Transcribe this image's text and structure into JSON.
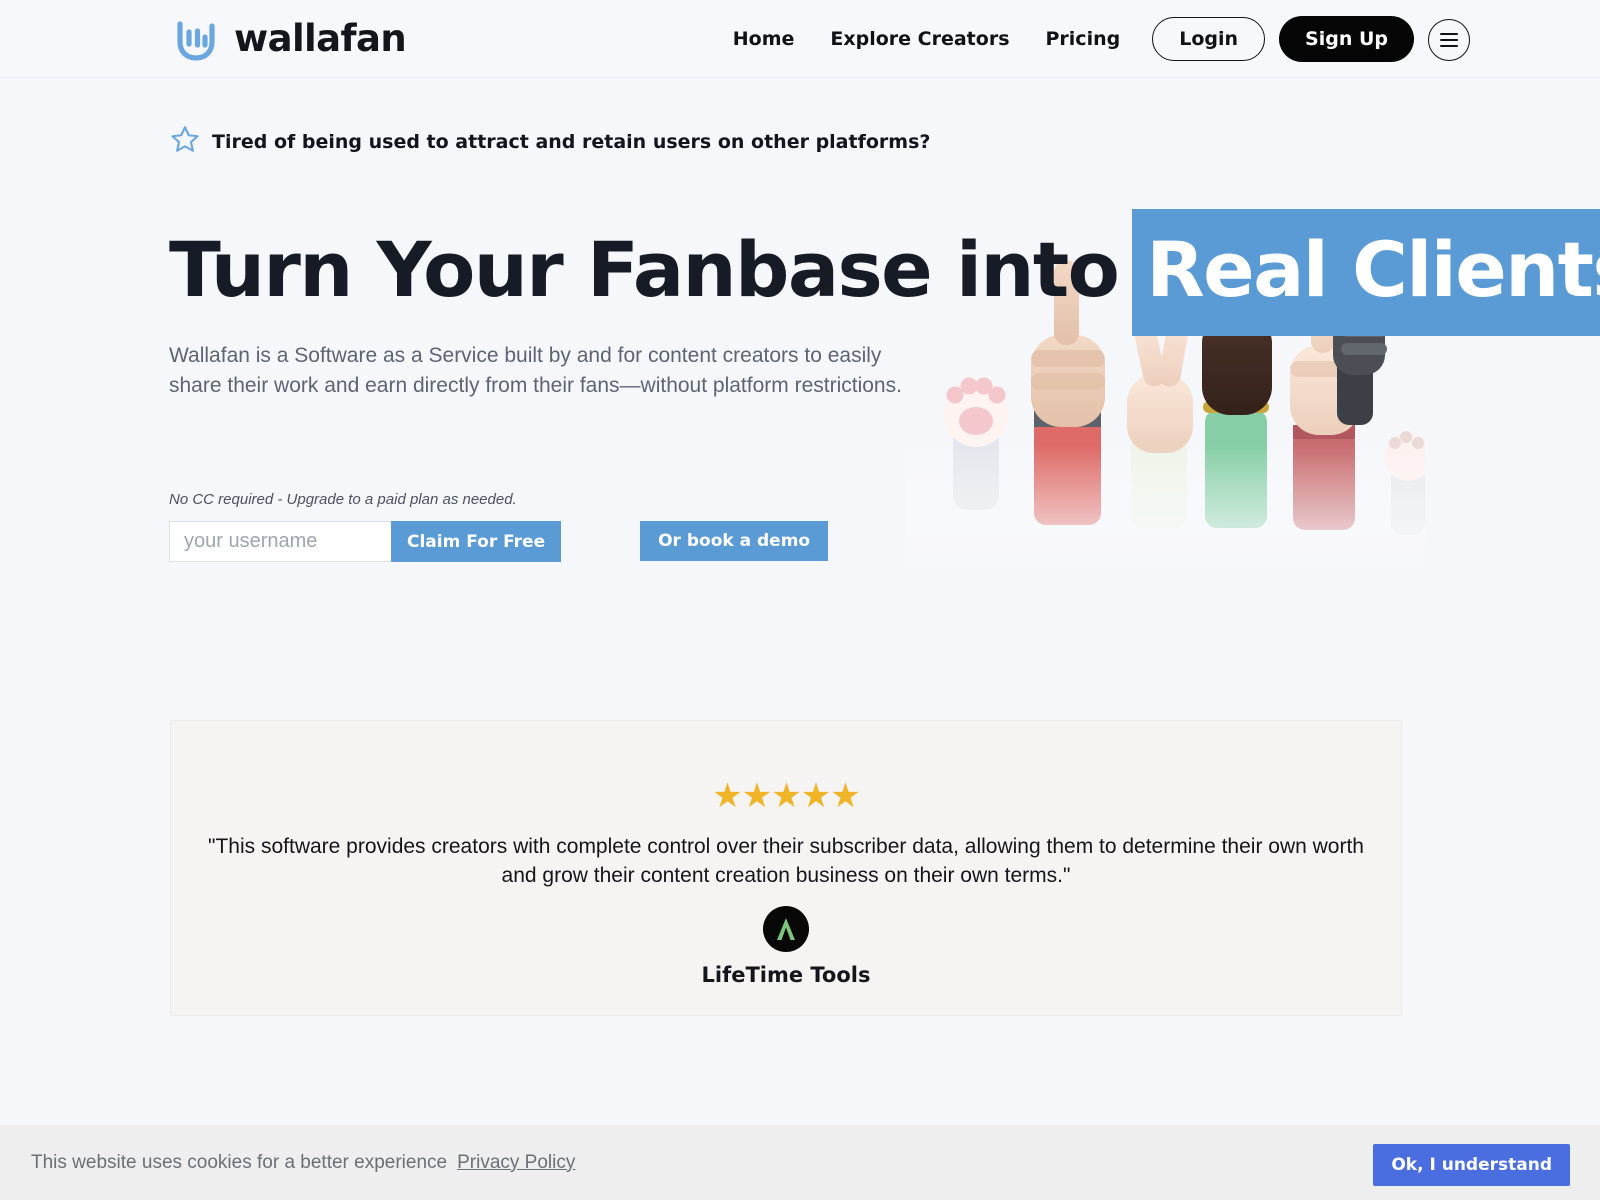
{
  "header": {
    "brand_name": "wallafan",
    "brand_mark_icon": "rock-hand-logo-icon",
    "nav": [
      {
        "label": "Home"
      },
      {
        "label": "Explore Creators"
      },
      {
        "label": "Pricing"
      }
    ],
    "login_label": "Login",
    "signup_label": "Sign Up",
    "menu_icon": "hamburger-menu-icon"
  },
  "hero": {
    "tagline_icon": "star-outline-icon",
    "tagline": "Tired of being used to attract and retain users on other platforms?",
    "headline_prefix": "Turn Your Fanbase into",
    "headline_highlight": "Real Clients",
    "subhead": "Wallafan is a Software as a Service built by and for content creators to easily share their work and earn directly from their fans—without platform restrictions.",
    "cc_note": "No CC required - Upgrade to a paid plan as needed.",
    "username_placeholder": "your username",
    "username_value": "",
    "claim_label": "Claim For Free",
    "demo_label": "Or book a demo",
    "art_icon": "raised-hands-illustration"
  },
  "testimonial": {
    "stars": "★★★★★",
    "rating": 5,
    "quote": "\"This software provides creators with complete control over their subscriber data, allowing them to determine their own worth and grow their content creation business on their own terms.\"",
    "company_logo_icon": "lifetime-tools-logo-icon",
    "company_name": "LifeTime Tools"
  },
  "cookie": {
    "message": "This website uses cookies for a better experience",
    "privacy_label": "Privacy Policy",
    "accept_label": "Ok, I understand"
  },
  "colors": {
    "page_bg": "#f6f7fb",
    "accent_blue": "#5b9bd5",
    "dark": "#161b26",
    "star_gold": "#f0b429",
    "cookie_button": "#4a6ee0",
    "card_bg": "#f5f4f3",
    "logo_green": "#7dc47e"
  }
}
